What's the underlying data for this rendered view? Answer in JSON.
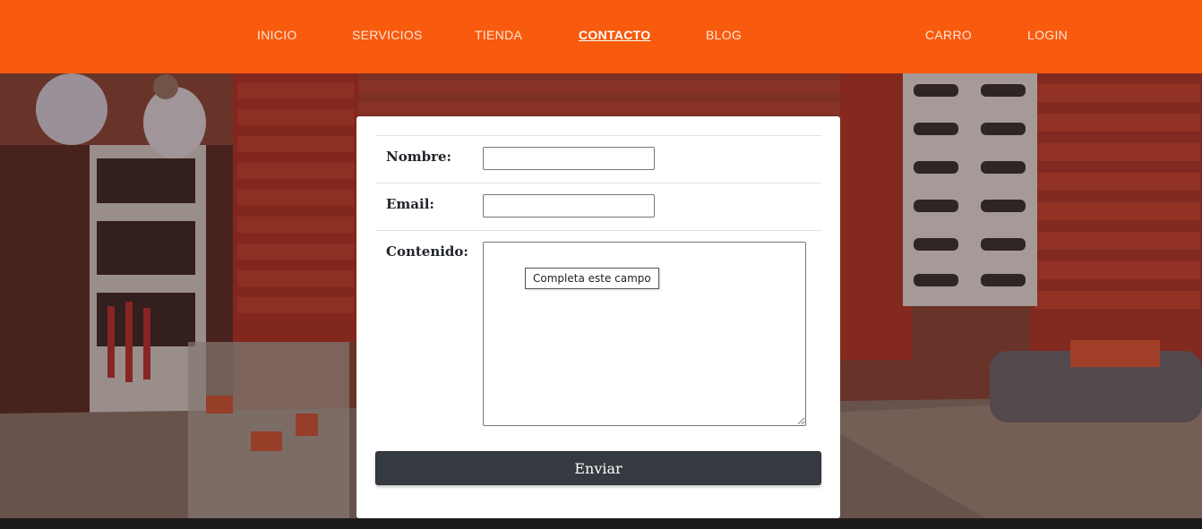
{
  "nav": {
    "items": [
      {
        "label": "INICIO",
        "active": false
      },
      {
        "label": "SERVICIOS",
        "active": false
      },
      {
        "label": "TIENDA",
        "active": false
      },
      {
        "label": "CONTACTO",
        "active": true
      },
      {
        "label": "BLOG",
        "active": false
      },
      {
        "label": "CARRO",
        "active": false
      },
      {
        "label": "LOGIN",
        "active": false
      }
    ]
  },
  "form": {
    "nombre_label": "Nombre:",
    "nombre_value": "",
    "email_label": "Email:",
    "email_value": "",
    "contenido_label": "Contenido:",
    "contenido_value": "",
    "tooltip": "Completa este campo",
    "submit_label": "Enviar"
  },
  "colors": {
    "navbar": "#f85a0e",
    "button": "#343a40",
    "card": "#ffffff"
  }
}
